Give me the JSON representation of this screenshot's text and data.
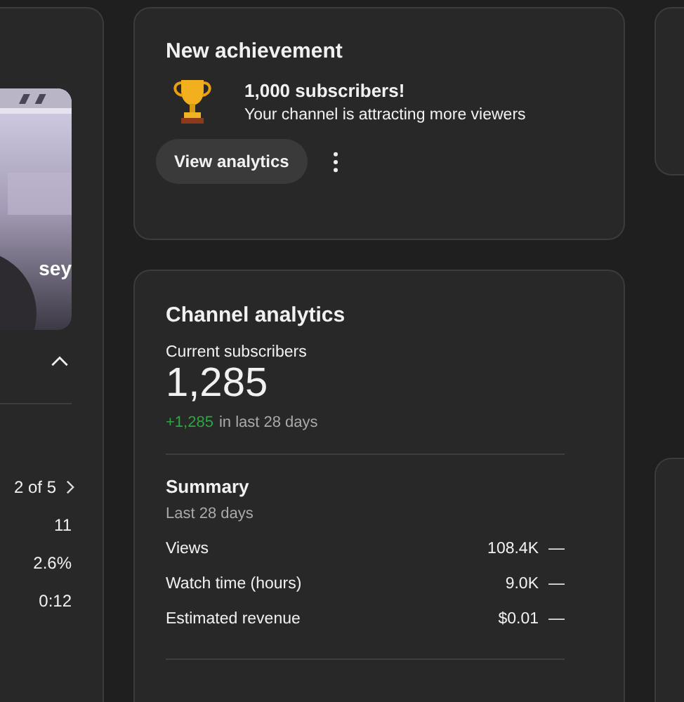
{
  "left_card": {
    "thumbnail": {
      "kind": "picture",
      "caption": "sey"
    },
    "pager": "2 of 5",
    "values": [
      "11",
      "2.6%",
      "0:12"
    ]
  },
  "achievement": {
    "title": "New achievement",
    "headline": "1,000 subscribers!",
    "message": "Your channel is attracting more viewers",
    "button": "View analytics"
  },
  "analytics": {
    "title": "Channel analytics",
    "subscribers_label": "Current subscribers",
    "subscribers": "1,285",
    "change": "+1,285",
    "change_period": "in last 28 days",
    "summary_title": "Summary",
    "summary_period": "Last 28 days",
    "metrics": [
      {
        "label": "Views",
        "value": "108.4K",
        "trend": "—"
      },
      {
        "label": "Watch time (hours)",
        "value": "9.0K",
        "trend": "—"
      },
      {
        "label": "Estimated revenue",
        "value": "$0.01",
        "trend": "—"
      }
    ]
  }
}
